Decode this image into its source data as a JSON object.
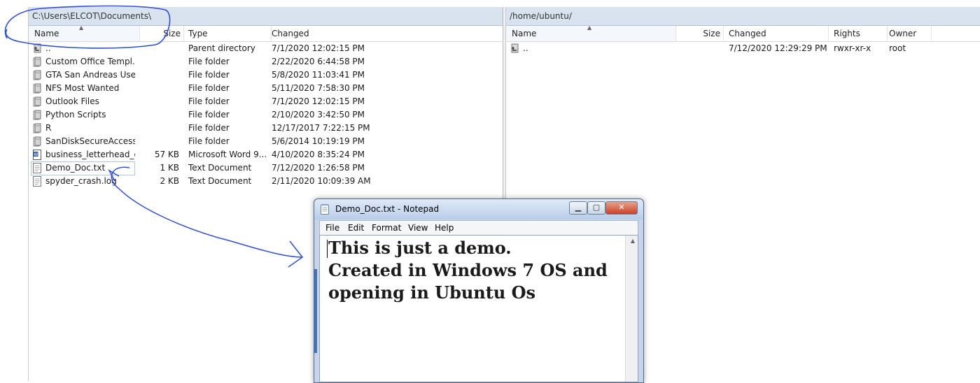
{
  "left": {
    "path": "C:\\Users\\ELCOT\\Documents\\",
    "columns": {
      "name": "Name",
      "size": "Size",
      "type": "Type",
      "changed": "Changed"
    },
    "sort_indicator": "▲",
    "rows": [
      {
        "name": "..",
        "size": "",
        "type": "Parent directory",
        "changed": "7/1/2020  12:02:15 PM",
        "icon": "parent-dir-icon"
      },
      {
        "name": "Custom Office Templ...",
        "size": "",
        "type": "File folder",
        "changed": "2/22/2020  6:44:58 PM",
        "icon": "folder-icon"
      },
      {
        "name": "GTA San Andreas Use...",
        "size": "",
        "type": "File folder",
        "changed": "5/8/2020  11:03:41 PM",
        "icon": "folder-icon"
      },
      {
        "name": "NFS Most Wanted",
        "size": "",
        "type": "File folder",
        "changed": "5/11/2020  7:58:30 PM",
        "icon": "folder-icon"
      },
      {
        "name": "Outlook Files",
        "size": "",
        "type": "File folder",
        "changed": "7/1/2020  12:02:15 PM",
        "icon": "folder-icon"
      },
      {
        "name": "Python Scripts",
        "size": "",
        "type": "File folder",
        "changed": "2/10/2020  3:42:50 PM",
        "icon": "folder-icon"
      },
      {
        "name": "R",
        "size": "",
        "type": "File folder",
        "changed": "12/17/2017  7:22:15 PM",
        "icon": "folder-icon"
      },
      {
        "name": "SanDiskSecureAccess ...",
        "size": "",
        "type": "File folder",
        "changed": "5/6/2014  10:19:19 PM",
        "icon": "folder-icon"
      },
      {
        "name": "business_letterhead_g...",
        "size": "57 KB",
        "type": "Microsoft Word 9...",
        "changed": "4/10/2020  8:35:24 PM",
        "icon": "word-doc-icon"
      },
      {
        "name": "Demo_Doc.txt",
        "size": "1 KB",
        "type": "Text Document",
        "changed": "7/12/2020  1:26:58 PM",
        "icon": "text-file-icon"
      },
      {
        "name": "spyder_crash.log",
        "size": "2 KB",
        "type": "Text Document",
        "changed": "2/11/2020  10:09:39 AM",
        "icon": "text-file-icon"
      }
    ]
  },
  "right": {
    "path": "/home/ubuntu/",
    "columns": {
      "name": "Name",
      "size": "Size",
      "changed": "Changed",
      "rights": "Rights",
      "owner": "Owner"
    },
    "sort_indicator": "▲",
    "rows": [
      {
        "name": "..",
        "size": "",
        "changed": "7/12/2020 12:29:29 PM",
        "rights": "rwxr-xr-x",
        "owner": "root",
        "icon": "parent-dir-icon"
      }
    ]
  },
  "notepad": {
    "title": "Demo_Doc.txt - Notepad",
    "buttons": {
      "minimize": "▁",
      "maximize": "▢",
      "close": "✕"
    },
    "menus": [
      "File",
      "Edit",
      "Format",
      "View",
      "Help"
    ],
    "lines": [
      "This is just a demo.",
      "Created in Windows 7 OS and",
      "opening in Ubuntu Os"
    ],
    "scroll_up_glyph": "▲"
  },
  "colors": {
    "annotation": "#2f4fd0",
    "path_bar": "#d9e2ef",
    "title_bar": "#b9cde8"
  }
}
